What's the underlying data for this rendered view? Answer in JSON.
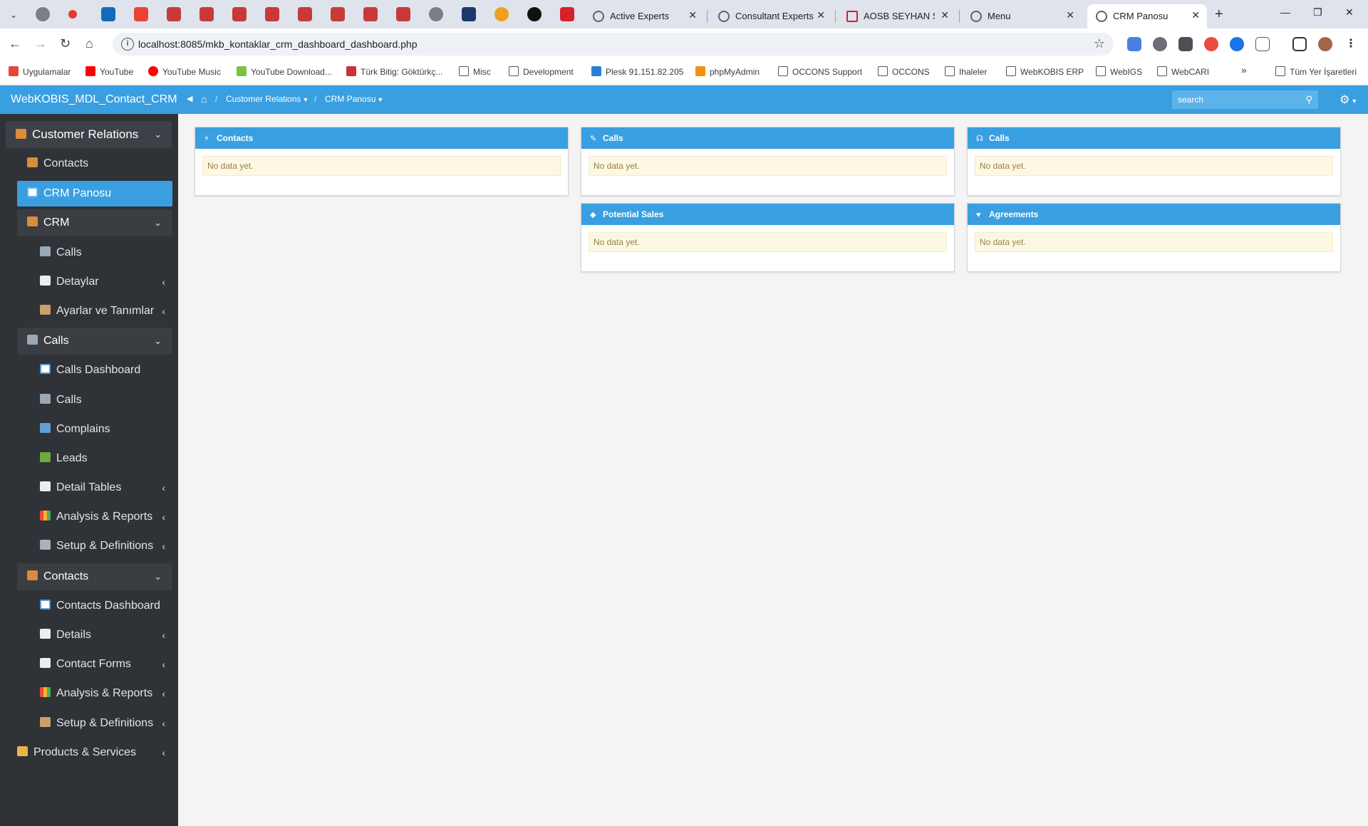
{
  "browser": {
    "tabs": [
      {
        "title": "Active Experts"
      },
      {
        "title": "Consultant Experts"
      },
      {
        "title": "AOSB SEYHAN SAL"
      },
      {
        "title": "Menu"
      },
      {
        "title": "CRM Panosu"
      }
    ],
    "url": "localhost:8085/mkb_kontaklar_crm_dashboard_dashboard.php",
    "bookmarks": [
      {
        "label": "Uygulamalar"
      },
      {
        "label": "YouTube"
      },
      {
        "label": "YouTube Music"
      },
      {
        "label": "YouTube Download..."
      },
      {
        "label": "Türk Bitig: Göktürkç..."
      },
      {
        "label": "Misc"
      },
      {
        "label": "Development"
      },
      {
        "label": "Plesk 91.151.82.205"
      },
      {
        "label": "phpMyAdmin"
      },
      {
        "label": "OCCONS Support"
      },
      {
        "label": "OCCONS"
      },
      {
        "label": "Ihaleler"
      },
      {
        "label": "WebKOBIS ERP"
      },
      {
        "label": "WebIGS"
      },
      {
        "label": "WebCARI"
      },
      {
        "label": "Tüm Yer İşaretleri"
      }
    ]
  },
  "app": {
    "brand": "WebKOBIS_MDL_Contact_CRM",
    "breadcrumb": {
      "level1": "Customer Relations",
      "level2": "CRM Panosu"
    },
    "search_placeholder": "search"
  },
  "sidebar": {
    "customer_relations": "Customer Relations",
    "contacts": "Contacts",
    "crm_panosu": "CRM Panosu",
    "crm": "CRM",
    "crm_calls": "Calls",
    "detaylar": "Detaylar",
    "ayarlar": "Ayarlar ve Tanımlar",
    "calls_group": "Calls",
    "calls_dashboard": "Calls Dashboard",
    "calls_calls": "Calls",
    "complains": "Complains",
    "leads": "Leads",
    "detail_tables": "Detail Tables",
    "calls_analysis": "Analysis & Reports",
    "calls_setup": "Setup & Definitions",
    "contacts_group": "Contacts",
    "contacts_dashboard": "Contacts Dashboard",
    "details": "Details",
    "contact_forms": "Contact Forms",
    "contacts_analysis": "Analysis & Reports",
    "contacts_setup": "Setup & Definitions",
    "products_services": "Products & Services"
  },
  "panels": {
    "contacts": {
      "title": "Contacts",
      "message": "No data yet."
    },
    "calls_1": {
      "title": "Calls",
      "message": "No data yet."
    },
    "calls_2": {
      "title": "Calls",
      "message": "No data yet."
    },
    "potential_sales": {
      "title": "Potential Sales",
      "message": "No data yet."
    },
    "agreements": {
      "title": "Agreements",
      "message": "No data yet."
    }
  },
  "colors": {
    "accent": "#3a9fe0",
    "sidebar_bg": "#2f3237",
    "no_data_bg": "#fcf8e3",
    "no_data_text": "#9a8046"
  }
}
